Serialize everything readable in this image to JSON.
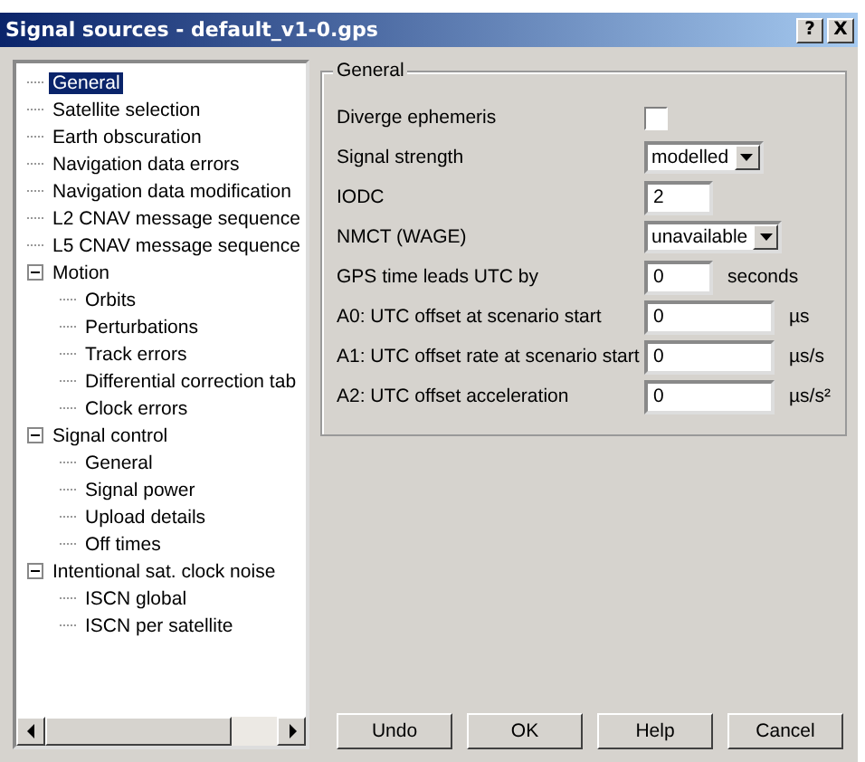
{
  "window": {
    "title": "Signal sources - default_v1-0.gps",
    "title_buttons": [
      "?",
      "X"
    ]
  },
  "tree": [
    {
      "label": "General",
      "selected": true
    },
    {
      "label": "Satellite selection",
      "selected": false
    },
    {
      "label": "Earth obscuration",
      "selected": false
    },
    {
      "label": "Navigation data errors",
      "selected": false
    },
    {
      "label": "Navigation data modification",
      "selected": false
    },
    {
      "label": "L2 CNAV message sequence",
      "selected": false
    },
    {
      "label": "L5 CNAV message sequence",
      "selected": false
    },
    {
      "label": "Motion",
      "selected": false,
      "expanded": true,
      "children": [
        {
          "label": "Orbits",
          "selected": false
        },
        {
          "label": "Perturbations",
          "selected": false
        },
        {
          "label": "Track errors",
          "selected": false
        },
        {
          "label": "Differential correction tab",
          "selected": false
        },
        {
          "label": "Clock errors",
          "selected": false
        }
      ]
    },
    {
      "label": "Signal control",
      "selected": false,
      "expanded": true,
      "children": [
        {
          "label": "General",
          "selected": false
        },
        {
          "label": "Signal power",
          "selected": false
        },
        {
          "label": "Upload details",
          "selected": false
        },
        {
          "label": "Off times",
          "selected": false
        }
      ]
    },
    {
      "label": "Intentional sat. clock noise",
      "selected": false,
      "expanded": true,
      "children": [
        {
          "label": "ISCN global",
          "selected": false
        },
        {
          "label": "ISCN per satellite",
          "selected": false
        }
      ]
    }
  ],
  "group": {
    "title": "General",
    "fields": [
      {
        "kind": "checkbox",
        "label": "Diverge ephemeris",
        "checked": false
      },
      {
        "kind": "dropdown",
        "label": "Signal strength",
        "value": "modelled"
      },
      {
        "kind": "short_text",
        "label": "IODC",
        "value": "2"
      },
      {
        "kind": "dropdown",
        "label": "NMCT (WAGE)",
        "value": "unavailable"
      },
      {
        "kind": "short_text",
        "label": "GPS time leads UTC by",
        "value": "0",
        "unit": "seconds"
      },
      {
        "kind": "text",
        "label": "A0: UTC offset at scenario start",
        "value": "0",
        "unit": "µs"
      },
      {
        "kind": "text",
        "label": "A1: UTC offset rate at scenario start",
        "value": "0",
        "unit": "µs/s"
      },
      {
        "kind": "text",
        "label": "A2: UTC offset acceleration",
        "value": "0",
        "unit": "µs/s²"
      }
    ]
  },
  "buttons": [
    "Undo",
    "OK",
    "Help",
    "Cancel"
  ]
}
